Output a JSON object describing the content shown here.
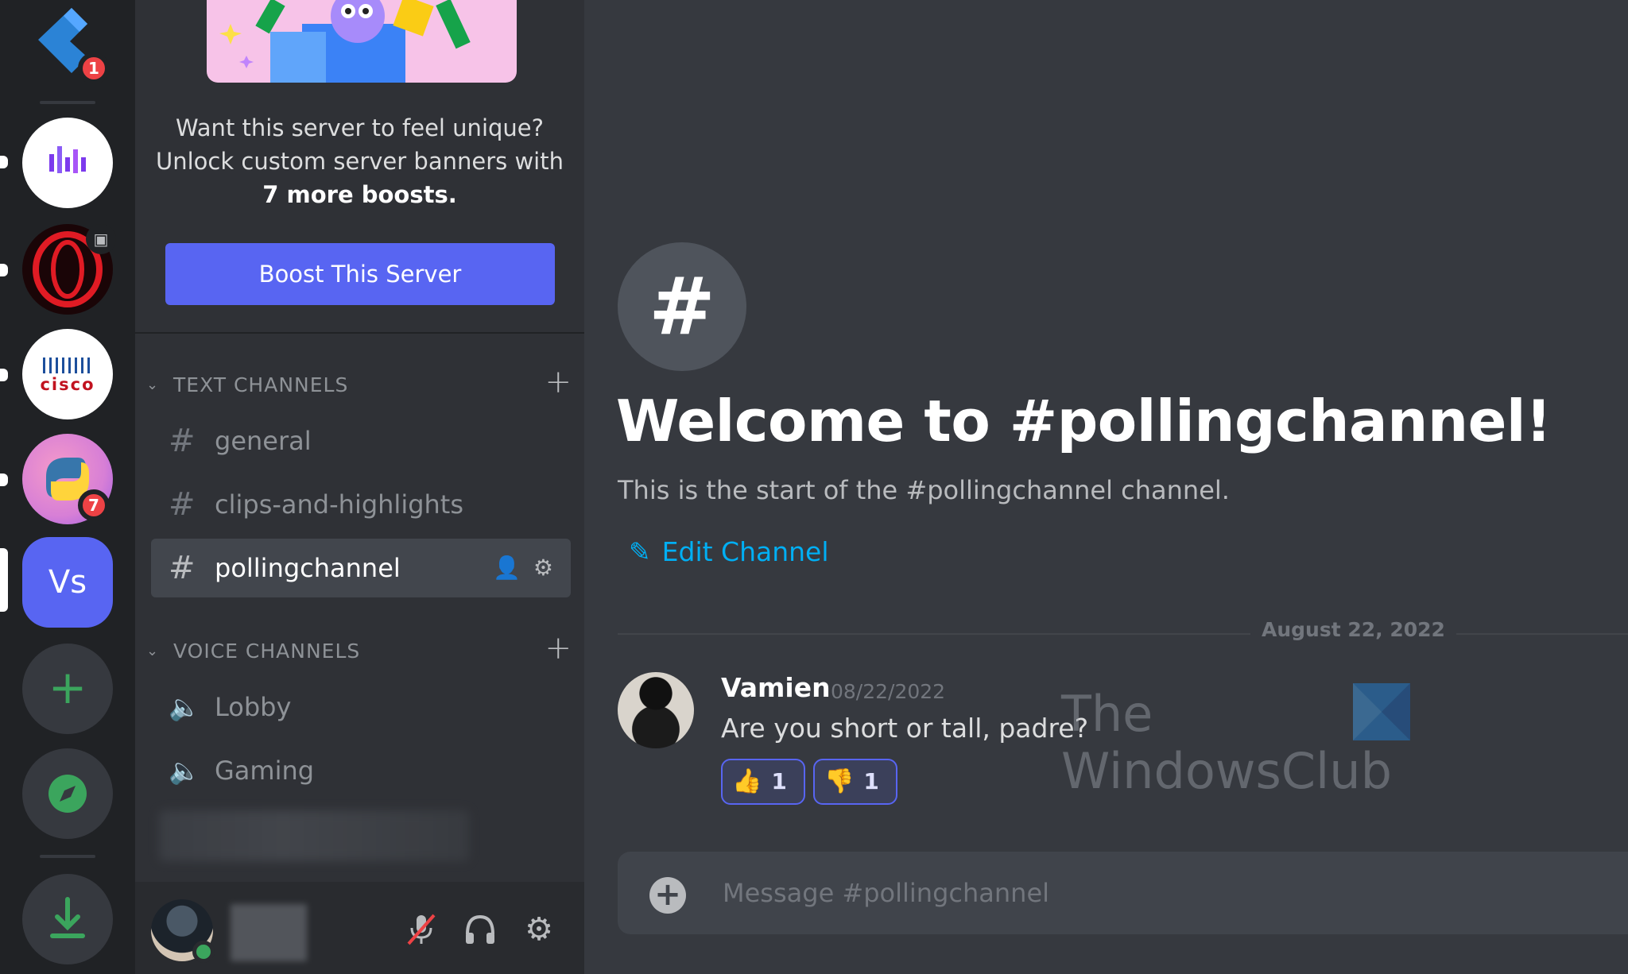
{
  "servers": {
    "home_badge": "1",
    "cisco_label": "cisco",
    "python_badge": "7",
    "vs_label": "Vs"
  },
  "sidebar": {
    "boost_prompt_line1": "Want this server to feel unique?",
    "boost_prompt_line2": "Unlock custom server banners with",
    "boost_prompt_bold": "7 more boosts.",
    "boost_button": "Boost This Server",
    "text_category": "TEXT CHANNELS",
    "voice_category": "VOICE CHANNELS",
    "text_channels": [
      {
        "name": "general"
      },
      {
        "name": "clips-and-highlights"
      },
      {
        "name": "pollingchannel"
      }
    ],
    "voice_channels": [
      {
        "name": "Lobby"
      },
      {
        "name": "Gaming"
      }
    ]
  },
  "main": {
    "welcome_title": "Welcome to #pollingchannel!",
    "welcome_subtitle": "This is the start of the #pollingchannel channel.",
    "edit_channel": "Edit Channel",
    "date_divider": "August 22, 2022",
    "message": {
      "author": "Vamien",
      "timestamp": "08/22/2022",
      "text": "Are you short or tall, padre?",
      "reactions": [
        {
          "emoji": "thumbs-up",
          "count": "1"
        },
        {
          "emoji": "thumbs-down",
          "count": "1"
        }
      ]
    },
    "composer_placeholder": "Message #pollingchannel"
  },
  "watermark": {
    "line1": "The",
    "line2": "WindowsClub"
  },
  "colors": {
    "accent": "#5865f2",
    "link": "#00aff4",
    "online": "#3ba55d",
    "badge": "#ed4245"
  }
}
